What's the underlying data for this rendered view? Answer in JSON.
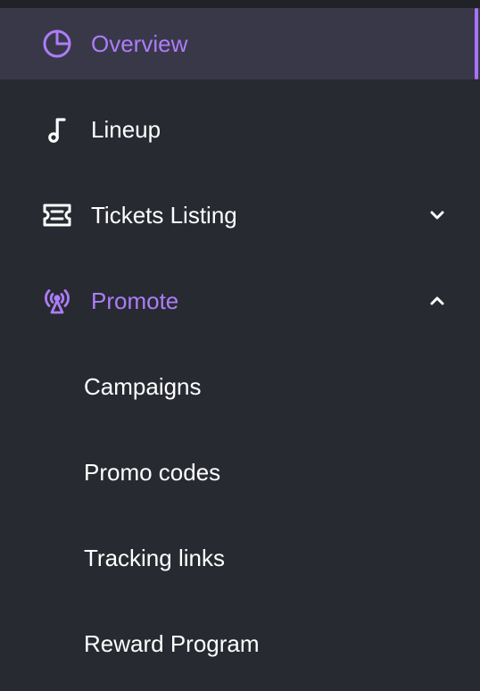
{
  "colors": {
    "background": "#272a31",
    "active_background": "#393849",
    "accent": "#a773f7",
    "text": "#ffffff"
  },
  "nav": {
    "overview": {
      "label": "Overview",
      "icon": "pie-chart-icon",
      "active": true
    },
    "lineup": {
      "label": "Lineup",
      "icon": "music-note-icon"
    },
    "tickets": {
      "label": "Tickets Listing",
      "icon": "ticket-icon",
      "chevron": "chevron-down-icon"
    },
    "promote": {
      "label": "Promote",
      "icon": "broadcast-icon",
      "chevron": "chevron-up-icon",
      "expanded": true
    }
  },
  "promote_sub": [
    {
      "label": "Campaigns"
    },
    {
      "label": "Promo codes"
    },
    {
      "label": "Tracking links"
    },
    {
      "label": "Reward Program"
    }
  ]
}
